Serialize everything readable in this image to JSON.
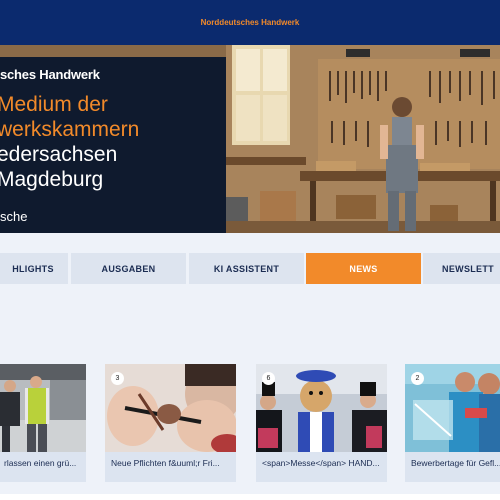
{
  "header": {
    "title": "Norddeutsches Handwerk"
  },
  "hero": {
    "brand": "sches Handwerk",
    "headline_lines": [
      {
        "text": "Medium der",
        "color": "orange"
      },
      {
        "text": "werkskammern",
        "color": "orange"
      },
      {
        "text": "edersachsen",
        "color": "white"
      },
      {
        "text": "Magdeburg",
        "color": "white"
      }
    ],
    "tagline": "sche"
  },
  "nav": {
    "items": [
      {
        "label": "HLIGHTS",
        "active": false
      },
      {
        "label": "AUSGABEN",
        "active": false
      },
      {
        "label": "KI ASSISTENT",
        "active": false
      },
      {
        "label": "NEWS",
        "active": true
      },
      {
        "label": "NEWSLETT",
        "active": false
      }
    ]
  },
  "news": {
    "cards": [
      {
        "caption": "rlassen einen grü...",
        "badge": ""
      },
      {
        "caption": "Neue Pflichten f&uuml;r Fri...",
        "badge": "3"
      },
      {
        "caption": "<span>Messe</span> HAND...",
        "badge": "6"
      },
      {
        "caption": "Bewerbertage für Gefl...",
        "badge": "2"
      }
    ]
  },
  "colors": {
    "navy": "#0b2a6e",
    "accent": "#f28a2a",
    "nav_bg": "#dde4ef",
    "page_bg": "#eef2f9"
  }
}
